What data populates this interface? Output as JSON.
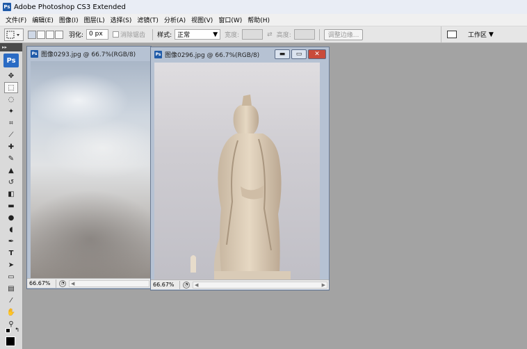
{
  "app": {
    "badge": "Ps",
    "title": "Adobe Photoshop CS3 Extended"
  },
  "menu": [
    "文件(F)",
    "编辑(E)",
    "图像(I)",
    "图层(L)",
    "选择(S)",
    "滤镜(T)",
    "分析(A)",
    "视图(V)",
    "窗口(W)",
    "帮助(H)"
  ],
  "options": {
    "feather_label": "羽化:",
    "feather_value": "0 px",
    "antialias_label": "消除锯齿",
    "style_label": "样式:",
    "style_value": "正常",
    "width_label": "宽度:",
    "height_label": "高度:",
    "refine_label": "调整边缘...",
    "workspace_label": "工作区"
  },
  "toolbox": {
    "header": "▸▸",
    "logo": "Ps"
  },
  "windows": [
    {
      "title": "图像0293.jpg @ 66.7%(RGB/8)",
      "zoom": "66.67%"
    },
    {
      "title": "图像0296.jpg @ 66.7%(RGB/8)",
      "zoom": "66.67%"
    }
  ],
  "icons": {
    "app": "ps-icon",
    "minimize": "minimize-icon",
    "restore": "restore-icon",
    "close": "close-icon",
    "move": "move-tool-icon",
    "marquee": "rect-marquee-icon",
    "lasso": "lasso-icon"
  }
}
